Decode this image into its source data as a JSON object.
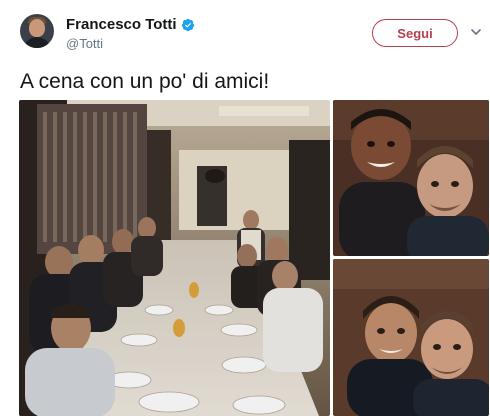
{
  "tweet": {
    "author": {
      "display_name": "Francesco Totti",
      "handle": "@Totti",
      "verified": true,
      "avatar_icon": "profile-avatar"
    },
    "follow_label": "Segui",
    "more_icon": "chevron-down-icon",
    "text": "A cena con un po' di amici!",
    "media": [
      {
        "label": "group-dinner-photo"
      },
      {
        "label": "selfie-photo-1"
      },
      {
        "label": "selfie-photo-2"
      }
    ]
  },
  "colors": {
    "accent": "#b5404f",
    "verified": "#1da1f2",
    "muted": "#657786",
    "text": "#14171a"
  }
}
